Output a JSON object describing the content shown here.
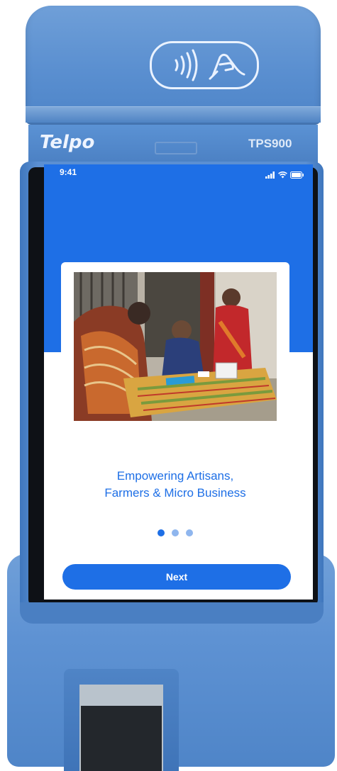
{
  "device": {
    "brand": "Telpo",
    "model": "TPS900",
    "nfc_icon": "contactless-payment-icon",
    "fingerprint_icon": "fingerprint-scanner-icon"
  },
  "status_bar": {
    "time": "9:41",
    "icons": [
      "signal-icon",
      "wifi-icon",
      "battery-icon"
    ]
  },
  "onboarding": {
    "image": "artisans-working-photo",
    "caption_line1": "Empowering Artisans,",
    "caption_line2": "Farmers & Micro Business",
    "pages": 3,
    "current_page": 1,
    "next_label": "Next"
  },
  "colors": {
    "accent": "#1e6fe6",
    "device_blue": "#5b8fd2",
    "dot_inactive": "#8fb6ee"
  }
}
